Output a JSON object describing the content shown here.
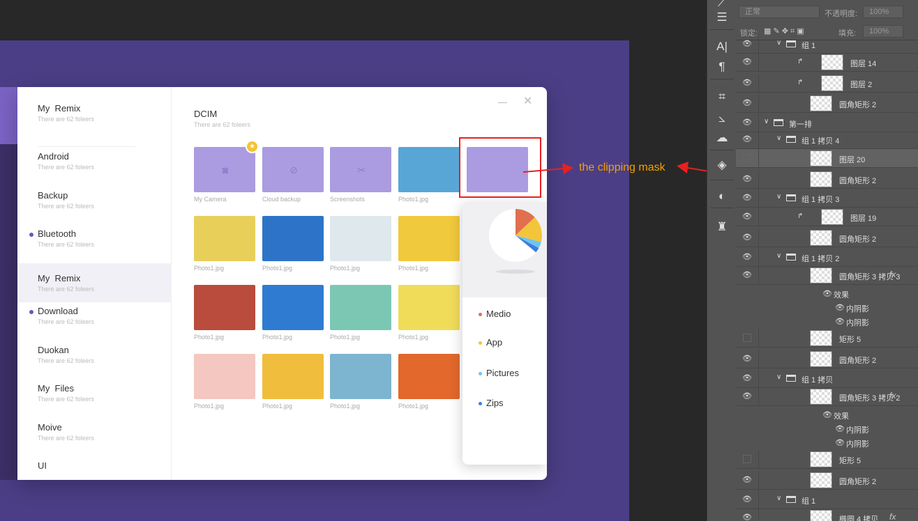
{
  "sidebar": {
    "items": [
      {
        "title": "My  Remix",
        "sub": "There are 62 foleers",
        "dot": false
      },
      {
        "title": "Android",
        "sub": "There are 62 foleers",
        "dot": false
      },
      {
        "title": "Backup",
        "sub": "There are 62 foleers",
        "dot": false
      },
      {
        "title": "Bluetooth",
        "sub": "There are 62 foleers",
        "dot": true
      },
      {
        "title": "My  Remix",
        "sub": "There are 62 foleers",
        "dot": false,
        "active": true
      },
      {
        "title": "Download",
        "sub": "There are 62 foleers",
        "dot": true
      },
      {
        "title": "Duokan",
        "sub": "There are 62 foleers",
        "dot": false
      },
      {
        "title": "My  Files",
        "sub": "There are 62 foleers",
        "dot": false
      },
      {
        "title": "Moive",
        "sub": "There are 62 foleers",
        "dot": false
      },
      {
        "title": "UI",
        "sub": "",
        "dot": false
      }
    ]
  },
  "main": {
    "title": "DCIM",
    "subtitle": "There are 62 foleers",
    "folders": [
      {
        "label": "My Camera",
        "icon": "camera-icon"
      },
      {
        "label": "Cloud backup",
        "icon": "cloud-icon"
      },
      {
        "label": "Screenshots",
        "icon": "scissors-icon"
      }
    ],
    "photo_label": "Photo1.jpg",
    "photo_colors": [
      "#58a6d6",
      "#e8cf5a",
      "#2d74c8",
      "#dfe8ec",
      "#f1c93c",
      "#b94c3c",
      "#2f7bd2",
      "#7cc7b4",
      "#f1dc5a",
      "#f4c7c0",
      "#f1bd3d",
      "#7db4cf",
      "#e2682c"
    ]
  },
  "popup": {
    "legend": [
      {
        "label": "Medio",
        "color": "#e07050"
      },
      {
        "label": "App",
        "color": "#f3c53a"
      },
      {
        "label": "Pictures",
        "color": "#6ec4f0"
      },
      {
        "label": "Zips",
        "color": "#3a7fe0"
      }
    ],
    "pie": [
      {
        "color": "#e07050",
        "value": 0.13
      },
      {
        "color": "#f3c53a",
        "value": 0.16
      },
      {
        "color": "#6ec4f0",
        "value": 0.04
      },
      {
        "color": "#3a7fe0",
        "value": 0.03
      }
    ]
  },
  "annotation": {
    "text": "the clipping mask",
    "color": "#e82020",
    "text_color": "#f2a000"
  },
  "layers_panel": {
    "blend_mode": "正常",
    "opacity_label": "不透明度:",
    "opacity_value": "100%",
    "lock_label": "锁定:",
    "fill_label": "填充:",
    "fill_value": "100%",
    "rows": [
      {
        "name": "组 1",
        "type": "group",
        "eye": true
      },
      {
        "name": "图层 14",
        "type": "layer",
        "eye": true,
        "clip": true
      },
      {
        "name": "图层 2",
        "type": "layer",
        "eye": true,
        "clip": true
      },
      {
        "name": "圆角矩形 2",
        "type": "shape",
        "eye": true
      },
      {
        "name": "第一排",
        "type": "group",
        "eye": true
      },
      {
        "name": "组 1 拷贝 4",
        "type": "group",
        "eye": true
      },
      {
        "name": "图层 20",
        "type": "layer",
        "eye": false,
        "highlight": true
      },
      {
        "name": "圆角矩形 2",
        "type": "shape",
        "eye": true
      },
      {
        "name": "组 1 拷贝 3",
        "type": "group",
        "eye": true
      },
      {
        "name": "图层 19",
        "type": "layer",
        "eye": true,
        "clip": true
      },
      {
        "name": "圆角矩形 2",
        "type": "shape",
        "eye": true
      },
      {
        "name": "组 1 拷贝 2",
        "type": "group",
        "eye": true
      },
      {
        "name": "圆角矩形 3 拷贝 3",
        "type": "shape",
        "eye": true,
        "fx": true
      },
      {
        "name": "效果",
        "type": "effect",
        "eye": true
      },
      {
        "name": "内阴影",
        "type": "effect",
        "eye": true
      },
      {
        "name": "内阴影",
        "type": "effect",
        "eye": true
      },
      {
        "name": "矩形 5",
        "type": "shape",
        "eye": false
      },
      {
        "name": "圆角矩形 2",
        "type": "shape",
        "eye": true
      },
      {
        "name": "组 1 拷贝",
        "type": "group",
        "eye": true
      },
      {
        "name": "圆角矩形 3 拷贝 2",
        "type": "shape",
        "eye": true,
        "fx": true
      },
      {
        "name": "效果",
        "type": "effect",
        "eye": true
      },
      {
        "name": "内阴影",
        "type": "effect",
        "eye": true
      },
      {
        "name": "内阴影",
        "type": "effect",
        "eye": true
      },
      {
        "name": "矩形 5",
        "type": "shape",
        "eye": false
      },
      {
        "name": "圆角矩形 2",
        "type": "shape",
        "eye": true
      },
      {
        "name": "组 1",
        "type": "group",
        "eye": true
      },
      {
        "name": "椭圆 4 拷贝",
        "type": "shape",
        "eye": true,
        "fx": true
      }
    ],
    "fx_label": "fx"
  },
  "tools": [
    "brush-icon",
    "adjust-icon",
    "type-icon",
    "paragraph-icon",
    "crop-icon",
    "ruler-icon",
    "smudge-icon",
    "3d-icon",
    "mask-icon",
    "stamp-icon"
  ]
}
